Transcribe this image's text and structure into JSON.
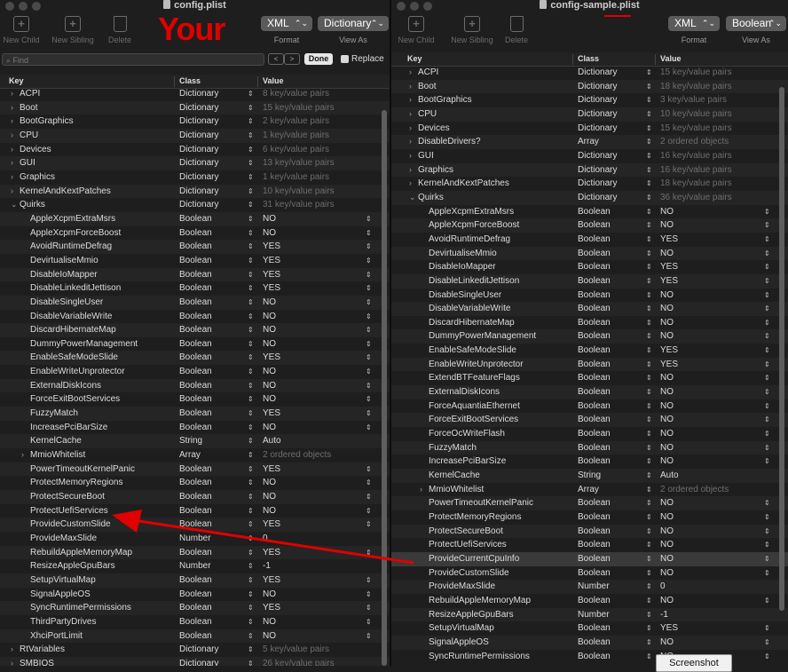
{
  "left": {
    "title": "config.plist",
    "toolbar": {
      "new_child": "New Child",
      "new_sibling": "New Sibling",
      "delete": "Delete",
      "format_value": "XML",
      "format_label": "Format",
      "view_value": "Dictionary",
      "view_label": "View As"
    },
    "find": {
      "placeholder": "Find",
      "done": "Done",
      "replace": "Replace",
      "prev": "<",
      "next": ">"
    },
    "annotation": "Your",
    "columns": {
      "key": "Key",
      "class": "Class",
      "value": "Value"
    },
    "rows": [
      {
        "key": "ACPI",
        "class": "Dictionary",
        "value": "8 key/value pairs",
        "disc": ">",
        "indent": 0,
        "dim": true
      },
      {
        "key": "Boot",
        "class": "Dictionary",
        "value": "15 key/value pairs",
        "disc": ">",
        "indent": 0,
        "dim": true
      },
      {
        "key": "BootGraphics",
        "class": "Dictionary",
        "value": "2 key/value pairs",
        "disc": ">",
        "indent": 0,
        "dim": true
      },
      {
        "key": "CPU",
        "class": "Dictionary",
        "value": "1 key/value pairs",
        "disc": ">",
        "indent": 0,
        "dim": true
      },
      {
        "key": "Devices",
        "class": "Dictionary",
        "value": "6 key/value pairs",
        "disc": ">",
        "indent": 0,
        "dim": true
      },
      {
        "key": "GUI",
        "class": "Dictionary",
        "value": "13 key/value pairs",
        "disc": ">",
        "indent": 0,
        "dim": true
      },
      {
        "key": "Graphics",
        "class": "Dictionary",
        "value": "1 key/value pairs",
        "disc": ">",
        "indent": 0,
        "dim": true
      },
      {
        "key": "KernelAndKextPatches",
        "class": "Dictionary",
        "value": "10 key/value pairs",
        "disc": ">",
        "indent": 0,
        "dim": true
      },
      {
        "key": "Quirks",
        "class": "Dictionary",
        "value": "31 key/value pairs",
        "disc": "v",
        "indent": 0,
        "dim": true
      },
      {
        "key": "AppleXcpmExtraMsrs",
        "class": "Boolean",
        "value": "NO",
        "indent": 1
      },
      {
        "key": "AppleXcpmForceBoost",
        "class": "Boolean",
        "value": "NO",
        "indent": 1
      },
      {
        "key": "AvoidRuntimeDefrag",
        "class": "Boolean",
        "value": "YES",
        "indent": 1
      },
      {
        "key": "DevirtualiseMmio",
        "class": "Boolean",
        "value": "YES",
        "indent": 1
      },
      {
        "key": "DisableIoMapper",
        "class": "Boolean",
        "value": "YES",
        "indent": 1
      },
      {
        "key": "DisableLinkeditJettison",
        "class": "Boolean",
        "value": "YES",
        "indent": 1
      },
      {
        "key": "DisableSingleUser",
        "class": "Boolean",
        "value": "NO",
        "indent": 1
      },
      {
        "key": "DisableVariableWrite",
        "class": "Boolean",
        "value": "NO",
        "indent": 1
      },
      {
        "key": "DiscardHibernateMap",
        "class": "Boolean",
        "value": "NO",
        "indent": 1
      },
      {
        "key": "DummyPowerManagement",
        "class": "Boolean",
        "value": "NO",
        "indent": 1
      },
      {
        "key": "EnableSafeModeSlide",
        "class": "Boolean",
        "value": "YES",
        "indent": 1
      },
      {
        "key": "EnableWriteUnprotector",
        "class": "Boolean",
        "value": "NO",
        "indent": 1
      },
      {
        "key": "ExternalDiskIcons",
        "class": "Boolean",
        "value": "NO",
        "indent": 1
      },
      {
        "key": "ForceExitBootServices",
        "class": "Boolean",
        "value": "NO",
        "indent": 1
      },
      {
        "key": "FuzzyMatch",
        "class": "Boolean",
        "value": "YES",
        "indent": 1
      },
      {
        "key": "IncreasePciBarSize",
        "class": "Boolean",
        "value": "NO",
        "indent": 1
      },
      {
        "key": "KernelCache",
        "class": "String",
        "value": "Auto",
        "indent": 1
      },
      {
        "key": "MmioWhitelist",
        "class": "Array",
        "value": "2 ordered objects",
        "disc": ">",
        "indent": 1,
        "dim": true
      },
      {
        "key": "PowerTimeoutKernelPanic",
        "class": "Boolean",
        "value": "YES",
        "indent": 1
      },
      {
        "key": "ProtectMemoryRegions",
        "class": "Boolean",
        "value": "NO",
        "indent": 1
      },
      {
        "key": "ProtectSecureBoot",
        "class": "Boolean",
        "value": "NO",
        "indent": 1
      },
      {
        "key": "ProtectUefiServices",
        "class": "Boolean",
        "value": "NO",
        "indent": 1
      },
      {
        "key": "ProvideCustomSlide",
        "class": "Boolean",
        "value": "YES",
        "indent": 1
      },
      {
        "key": "ProvideMaxSlide",
        "class": "Number",
        "value": "0",
        "indent": 1
      },
      {
        "key": "RebuildAppleMemoryMap",
        "class": "Boolean",
        "value": "YES",
        "indent": 1
      },
      {
        "key": "ResizeAppleGpuBars",
        "class": "Number",
        "value": "-1",
        "indent": 1
      },
      {
        "key": "SetupVirtualMap",
        "class": "Boolean",
        "value": "YES",
        "indent": 1
      },
      {
        "key": "SignalAppleOS",
        "class": "Boolean",
        "value": "NO",
        "indent": 1
      },
      {
        "key": "SyncRuntimePermissions",
        "class": "Boolean",
        "value": "YES",
        "indent": 1
      },
      {
        "key": "ThirdPartyDrives",
        "class": "Boolean",
        "value": "NO",
        "indent": 1
      },
      {
        "key": "XhciPortLimit",
        "class": "Boolean",
        "value": "NO",
        "indent": 1
      },
      {
        "key": "RtVariables",
        "class": "Dictionary",
        "value": "5 key/value pairs",
        "disc": ">",
        "indent": 0,
        "dim": true
      },
      {
        "key": "SMBIOS",
        "class": "Dictionary",
        "value": "26 key/value pairs",
        "disc": ">",
        "indent": 0,
        "dim": true
      }
    ]
  },
  "right": {
    "title": "config-sample.plist",
    "toolbar": {
      "new_child": "New Child",
      "new_sibling": "New Sibling",
      "delete": "Delete",
      "format_value": "XML",
      "format_label": "Format",
      "view_value": "Boolean",
      "view_label": "View As"
    },
    "columns": {
      "key": "Key",
      "class": "Class",
      "value": "Value"
    },
    "rows": [
      {
        "key": "ACPI",
        "class": "Dictionary",
        "value": "15 key/value pairs",
        "disc": ">",
        "indent": 0,
        "dim": true
      },
      {
        "key": "Boot",
        "class": "Dictionary",
        "value": "18 key/value pairs",
        "disc": ">",
        "indent": 0,
        "dim": true
      },
      {
        "key": "BootGraphics",
        "class": "Dictionary",
        "value": "3 key/value pairs",
        "disc": ">",
        "indent": 0,
        "dim": true
      },
      {
        "key": "CPU",
        "class": "Dictionary",
        "value": "10 key/value pairs",
        "disc": ">",
        "indent": 0,
        "dim": true
      },
      {
        "key": "Devices",
        "class": "Dictionary",
        "value": "15 key/value pairs",
        "disc": ">",
        "indent": 0,
        "dim": true
      },
      {
        "key": "DisableDrivers?",
        "class": "Array",
        "value": "2 ordered objects",
        "disc": ">",
        "indent": 0,
        "dim": true
      },
      {
        "key": "GUI",
        "class": "Dictionary",
        "value": "16 key/value pairs",
        "disc": ">",
        "indent": 0,
        "dim": true
      },
      {
        "key": "Graphics",
        "class": "Dictionary",
        "value": "16 key/value pairs",
        "disc": ">",
        "indent": 0,
        "dim": true
      },
      {
        "key": "KernelAndKextPatches",
        "class": "Dictionary",
        "value": "18 key/value pairs",
        "disc": ">",
        "indent": 0,
        "dim": true
      },
      {
        "key": "Quirks",
        "class": "Dictionary",
        "value": "36 key/value pairs",
        "disc": "v",
        "indent": 0,
        "dim": true
      },
      {
        "key": "AppleXcpmExtraMsrs",
        "class": "Boolean",
        "value": "NO",
        "indent": 1
      },
      {
        "key": "AppleXcpmForceBoost",
        "class": "Boolean",
        "value": "NO",
        "indent": 1
      },
      {
        "key": "AvoidRuntimeDefrag",
        "class": "Boolean",
        "value": "YES",
        "indent": 1
      },
      {
        "key": "DevirtualiseMmio",
        "class": "Boolean",
        "value": "NO",
        "indent": 1
      },
      {
        "key": "DisableIoMapper",
        "class": "Boolean",
        "value": "YES",
        "indent": 1
      },
      {
        "key": "DisableLinkeditJettison",
        "class": "Boolean",
        "value": "YES",
        "indent": 1
      },
      {
        "key": "DisableSingleUser",
        "class": "Boolean",
        "value": "NO",
        "indent": 1
      },
      {
        "key": "DisableVariableWrite",
        "class": "Boolean",
        "value": "NO",
        "indent": 1
      },
      {
        "key": "DiscardHibernateMap",
        "class": "Boolean",
        "value": "NO",
        "indent": 1
      },
      {
        "key": "DummyPowerManagement",
        "class": "Boolean",
        "value": "NO",
        "indent": 1
      },
      {
        "key": "EnableSafeModeSlide",
        "class": "Boolean",
        "value": "YES",
        "indent": 1
      },
      {
        "key": "EnableWriteUnprotector",
        "class": "Boolean",
        "value": "YES",
        "indent": 1
      },
      {
        "key": "ExtendBTFeatureFlags",
        "class": "Boolean",
        "value": "NO",
        "indent": 1
      },
      {
        "key": "ExternalDiskIcons",
        "class": "Boolean",
        "value": "NO",
        "indent": 1
      },
      {
        "key": "ForceAquantiaEthernet",
        "class": "Boolean",
        "value": "NO",
        "indent": 1
      },
      {
        "key": "ForceExitBootServices",
        "class": "Boolean",
        "value": "NO",
        "indent": 1
      },
      {
        "key": "ForceOcWriteFlash",
        "class": "Boolean",
        "value": "NO",
        "indent": 1
      },
      {
        "key": "FuzzyMatch",
        "class": "Boolean",
        "value": "NO",
        "indent": 1
      },
      {
        "key": "IncreasePciBarSize",
        "class": "Boolean",
        "value": "NO",
        "indent": 1
      },
      {
        "key": "KernelCache",
        "class": "String",
        "value": "Auto",
        "indent": 1
      },
      {
        "key": "MmioWhitelist",
        "class": "Array",
        "value": "2 ordered objects",
        "disc": ">",
        "indent": 1,
        "dim": true
      },
      {
        "key": "PowerTimeoutKernelPanic",
        "class": "Boolean",
        "value": "NO",
        "indent": 1
      },
      {
        "key": "ProtectMemoryRegions",
        "class": "Boolean",
        "value": "NO",
        "indent": 1
      },
      {
        "key": "ProtectSecureBoot",
        "class": "Boolean",
        "value": "NO",
        "indent": 1
      },
      {
        "key": "ProtectUefiServices",
        "class": "Boolean",
        "value": "NO",
        "indent": 1
      },
      {
        "key": "ProvideCurrentCpuInfo",
        "class": "Boolean",
        "value": "NO",
        "indent": 1,
        "highlight": true
      },
      {
        "key": "ProvideCustomSlide",
        "class": "Boolean",
        "value": "NO",
        "indent": 1
      },
      {
        "key": "ProvideMaxSlide",
        "class": "Number",
        "value": "0",
        "indent": 1
      },
      {
        "key": "RebuildAppleMemoryMap",
        "class": "Boolean",
        "value": "NO",
        "indent": 1
      },
      {
        "key": "ResizeAppleGpuBars",
        "class": "Number",
        "value": "-1",
        "indent": 1
      },
      {
        "key": "SetupVirtualMap",
        "class": "Boolean",
        "value": "YES",
        "indent": 1
      },
      {
        "key": "SignalAppleOS",
        "class": "Boolean",
        "value": "NO",
        "indent": 1
      },
      {
        "key": "SyncRuntimePermissions",
        "class": "Boolean",
        "value": "NO",
        "indent": 1
      }
    ]
  },
  "tooltip": "Screenshot",
  "colors": {
    "annotation": "#e00000",
    "background": "#1e1e1e",
    "highlight_row": "#3a3a3a"
  }
}
